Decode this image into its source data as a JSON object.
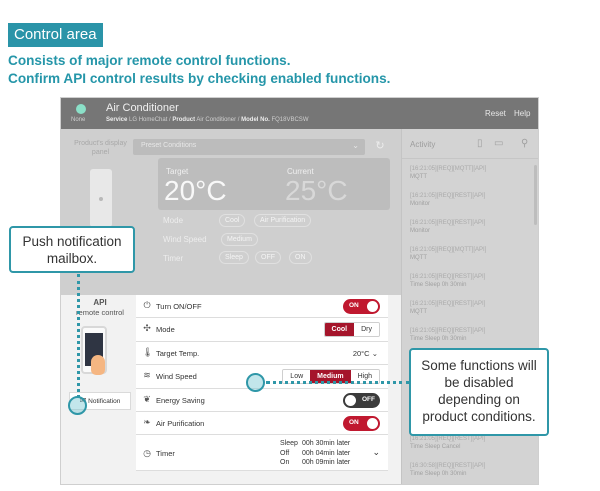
{
  "header": {
    "tag": "Control area",
    "line1": "Consists of major remote control functions.",
    "line2": "Confirm API control results by checking enabled functions."
  },
  "topbar": {
    "status": "None",
    "title": "Air Conditioner",
    "service_key": "Service",
    "service_val": "LG HomeChat",
    "product_key": "Product",
    "product_val": "Air Conditioner",
    "model_key": "Model No.",
    "model_val": "FQ18VBCSW",
    "reset": "Reset",
    "help": "Help"
  },
  "activity": {
    "title": "Activity",
    "items": [
      {
        "meta": "[16:21:05][REQ][MQTT][API]",
        "text": "MQTT"
      },
      {
        "meta": "[16:21:05][REQ][REST][API]",
        "text": "Monitor"
      },
      {
        "meta": "[16:21:05][REQ][REST][API]",
        "text": "Monitor"
      },
      {
        "meta": "[16:21:05][REQ][MQTT][API]",
        "text": "MQTT"
      },
      {
        "meta": "[16:21:05][REQ][REST][API]",
        "text": "Time Sleep 0h 30min"
      },
      {
        "meta": "[16:21:05][REQ][REST][API]",
        "text": "MQTT"
      },
      {
        "meta": "[16:21:05][REQ][REST][API]",
        "text": "Time Sleep 0h 30min"
      },
      {
        "meta": "[16:21:05][REQ][REST][API]",
        "text": "MQTT"
      },
      {
        "meta": "[16:21:05][REQ][MQTT][API]",
        "text": "MQTT"
      },
      {
        "meta": "[16:21:05][REQ][REST][API]",
        "text": "MQTT"
      },
      {
        "meta": "[16:21:05][REQ][REST][API]",
        "text": "Time Sleep Cancel"
      },
      {
        "meta": "[16:30:58][REQ][REST][API]",
        "text": "Time Sleep 0h 30min"
      }
    ]
  },
  "display": {
    "device_label": "Product's display panel",
    "preset": "Preset Conditions",
    "target_label": "Target",
    "target_value": "20°C",
    "current_label": "Current",
    "current_value": "25°C",
    "mode_label": "Mode",
    "mode_values": [
      "Cool",
      "Air Purification"
    ],
    "wind_label": "Wind Speed",
    "wind_value": "Medium",
    "timer_label": "Timer",
    "timer_values": [
      "Sleep",
      "OFF",
      "ON"
    ]
  },
  "api": {
    "title": "API",
    "subtitle": "remote control",
    "notification": "Notification"
  },
  "controls": {
    "turn_on_off": {
      "label": "Turn ON/OFF",
      "state": "ON"
    },
    "mode": {
      "label": "Mode",
      "options": [
        "Cool",
        "Dry"
      ],
      "selected": "Cool"
    },
    "target_temp": {
      "label": "Target Temp.",
      "value": "20°C"
    },
    "wind_speed": {
      "label": "Wind Speed",
      "options": [
        "Low",
        "Medium",
        "High"
      ],
      "selected": "Medium"
    },
    "energy_saving": {
      "label": "Energy Saving",
      "state": "OFF"
    },
    "air_purification": {
      "label": "Air Purification",
      "state": "ON"
    },
    "timer": {
      "label": "Timer",
      "lines": [
        {
          "key": "Sleep",
          "value": "00h 30min later"
        },
        {
          "key": "Off",
          "value": "00h 04min later"
        },
        {
          "key": "On",
          "value": "00h 09min later"
        }
      ]
    }
  },
  "callouts": {
    "notification": "Push notification mailbox.",
    "disabled": "Some functions will be disabled depending on product conditions."
  },
  "colors": {
    "accent": "#2a94a8",
    "active_red": "#c0182f",
    "off_dark": "#3b3b3b"
  }
}
